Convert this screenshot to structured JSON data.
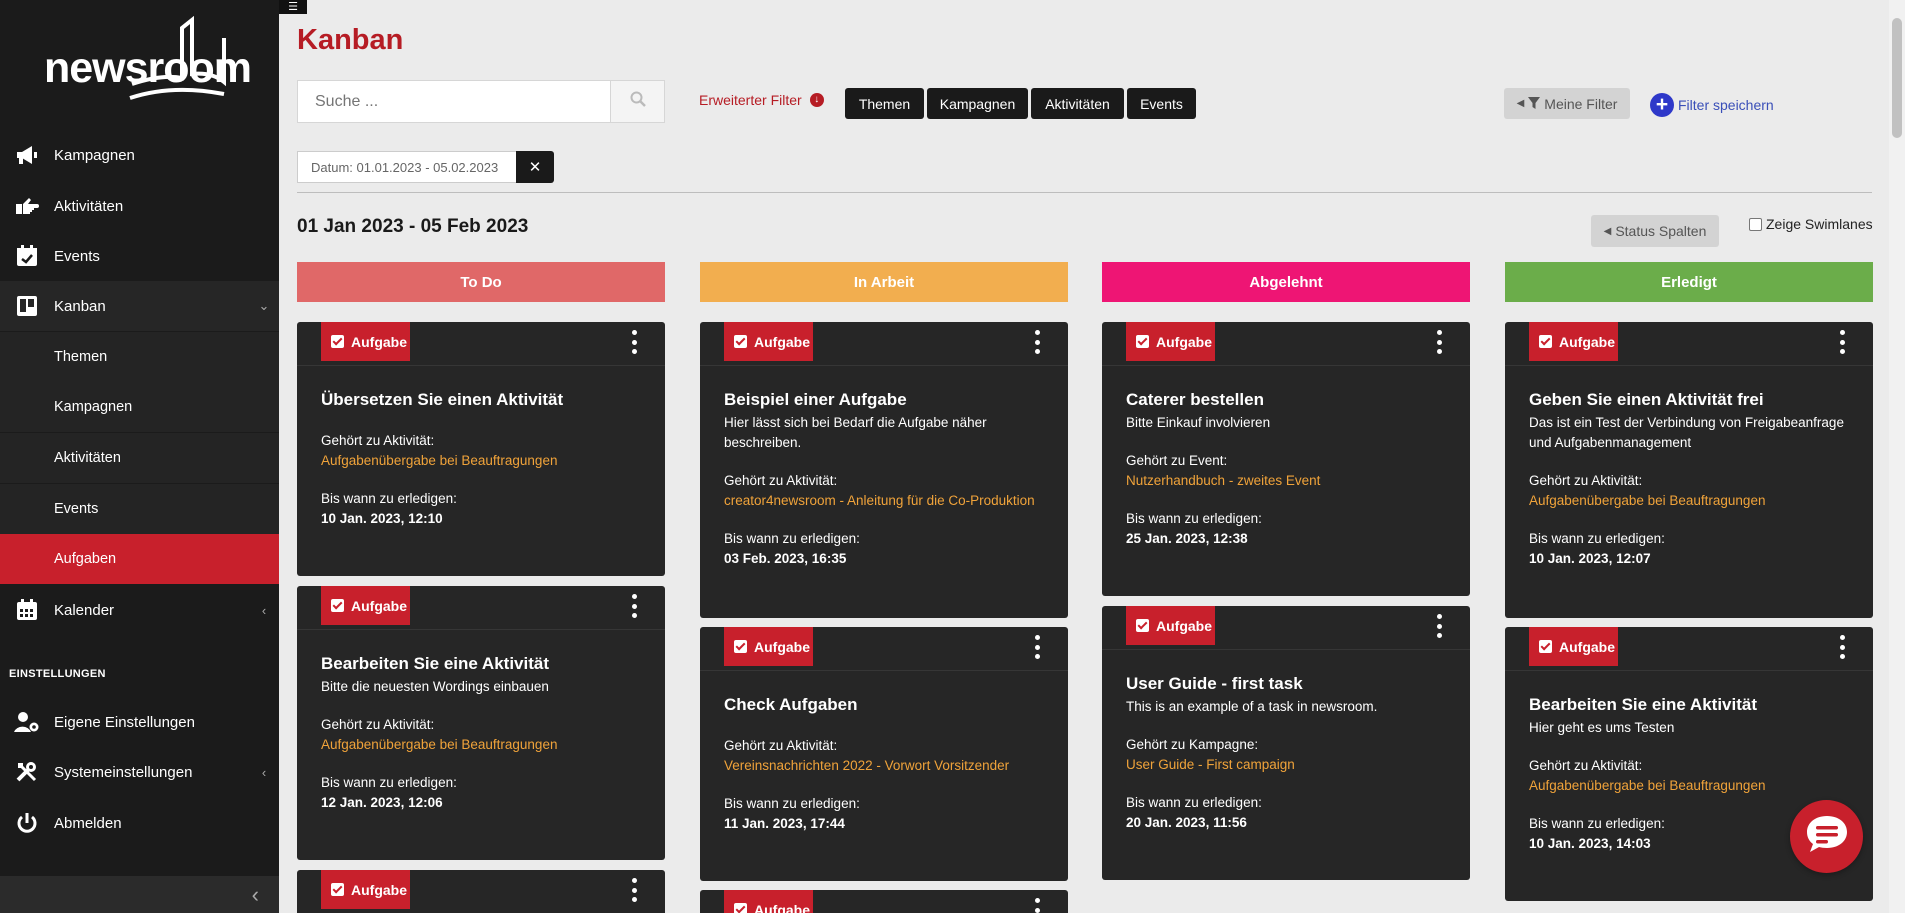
{
  "app": {
    "logo": "newsroom"
  },
  "sidebar": {
    "items": [
      {
        "label": "Kampagnen",
        "icon": "megaphone-icon"
      },
      {
        "label": "Aktivitäten",
        "icon": "pointing-hand-icon"
      },
      {
        "label": "Events",
        "icon": "calendar-check-icon"
      },
      {
        "label": "Kanban",
        "icon": "kanban-icon"
      },
      {
        "label": "Kalender",
        "icon": "calendar-icon"
      }
    ],
    "kanban_sub": [
      "Themen",
      "Kampagnen",
      "Aktivitäten",
      "Events",
      "Aufgaben"
    ],
    "section_label": "EINSTELLUNGEN",
    "settings": [
      {
        "label": "Eigene Einstellungen",
        "icon": "user-gear-icon"
      },
      {
        "label": "Systemeinstellungen",
        "icon": "tools-icon"
      },
      {
        "label": "Abmelden",
        "icon": "power-icon"
      }
    ]
  },
  "header": {
    "title": "Kanban",
    "search_placeholder": "Suche ...",
    "extended_filter": "Erweiterter Filter",
    "filter_buttons": [
      "Themen",
      "Kampagnen",
      "Aktivitäten",
      "Events"
    ],
    "my_filter": "Meine Filter",
    "save_filter": "Filter speichern",
    "date_chip": "Datum: 01.01.2023 - 05.02.2023",
    "range_title": "01 Jan 2023 - 05 Feb 2023",
    "status_columns": "Status Spalten",
    "swimlanes": "Zeige Swimlanes"
  },
  "colors": {
    "accent": "#c8202c",
    "todo": "#e06868",
    "in_progress": "#f2ae4f",
    "rejected": "#ee1574",
    "done": "#6bad4a"
  },
  "columns": [
    {
      "title": "To Do",
      "cards": [
        {
          "badge": "Aufgabe",
          "title": "Übersetzen Sie einen Aktivität",
          "desc": "",
          "ref_label": "Gehört zu Aktivität:",
          "ref": "Aufgabenübergabe bei Beauftragungen",
          "due_label": "Bis wann zu erledigen:",
          "due": "10 Jan. 2023, 12:10"
        },
        {
          "badge": "Aufgabe",
          "title": "Bearbeiten Sie eine Aktivität",
          "desc": "Bitte die neuesten Wordings einbauen",
          "ref_label": "Gehört zu Aktivität:",
          "ref": "Aufgabenübergabe bei Beauftragungen",
          "due_label": "Bis wann zu erledigen:",
          "due": "12 Jan. 2023, 12:06"
        },
        {
          "badge": "Aufgabe"
        }
      ]
    },
    {
      "title": "In Arbeit",
      "cards": [
        {
          "badge": "Aufgabe",
          "title": "Beispiel einer Aufgabe",
          "desc": "Hier lässt sich bei Bedarf die Aufgabe näher beschreiben.",
          "ref_label": "Gehört zu Aktivität:",
          "ref": "creator4newsroom - Anleitung für die Co-Produktion",
          "due_label": "Bis wann zu erledigen:",
          "due": "03 Feb. 2023, 16:35"
        },
        {
          "badge": "Aufgabe",
          "title": "Check Aufgaben",
          "desc": "",
          "ref_label": "Gehört zu Aktivität:",
          "ref": "Vereinsnachrichten 2022 - Vorwort Vorsitzender",
          "due_label": "Bis wann zu erledigen:",
          "due": "11 Jan. 2023, 17:44"
        },
        {
          "badge": "Aufgabe"
        }
      ]
    },
    {
      "title": "Abgelehnt",
      "cards": [
        {
          "badge": "Aufgabe",
          "title": "Caterer bestellen",
          "desc": "Bitte Einkauf involvieren",
          "ref_label": "Gehört zu Event:",
          "ref": "Nutzerhandbuch - zweites Event",
          "due_label": "Bis wann zu erledigen:",
          "due": "25 Jan. 2023, 12:38"
        },
        {
          "badge": "Aufgabe",
          "title": "User Guide - first task",
          "desc": "This is an example of a task in newsroom.",
          "ref_label": "Gehört zu Kampagne:",
          "ref": "User Guide - First campaign",
          "due_label": "Bis wann zu erledigen:",
          "due": "20 Jan. 2023, 11:56"
        }
      ]
    },
    {
      "title": "Erledigt",
      "cards": [
        {
          "badge": "Aufgabe",
          "title": "Geben Sie einen Aktivität frei",
          "desc": "Das ist ein Test der Verbindung von Freigabeanfrage und Aufgabenmanagement",
          "ref_label": "Gehört zu Aktivität:",
          "ref": "Aufgabenübergabe bei Beauftragungen",
          "due_label": "Bis wann zu erledigen:",
          "due": "10 Jan. 2023, 12:07"
        },
        {
          "badge": "Aufgabe",
          "title": "Bearbeiten Sie eine Aktivität",
          "desc": "Hier geht es ums Testen",
          "ref_label": "Gehört zu Aktivität:",
          "ref": "Aufgabenübergabe bei Beauftragungen",
          "due_label": "Bis wann zu erledigen:",
          "due": "10 Jan. 2023, 14:03"
        }
      ]
    }
  ]
}
